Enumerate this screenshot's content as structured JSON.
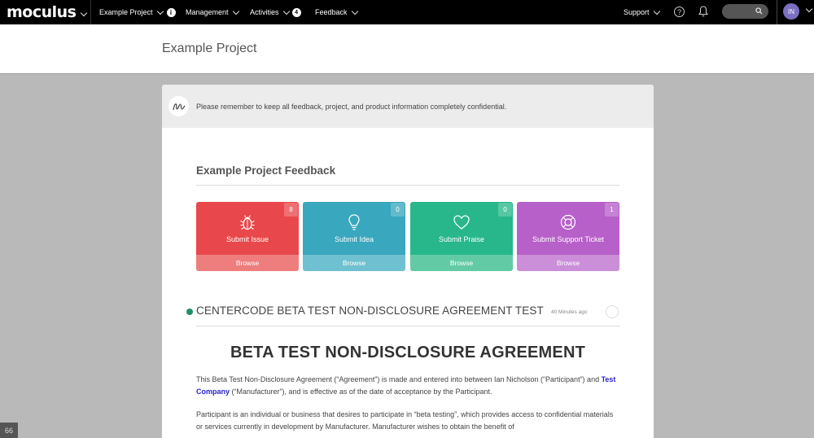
{
  "nav": {
    "brand": "moculus",
    "items": [
      {
        "label": "Example Project",
        "badge": "i"
      },
      {
        "label": "Management"
      },
      {
        "label": "Activities",
        "badge": "4"
      },
      {
        "label": "Feedback"
      }
    ],
    "support": "Support",
    "avatar_initials": "IN"
  },
  "page": {
    "title": "Example Project"
  },
  "notice": {
    "text": "Please remember to keep all feedback, project, and product information completely confidential."
  },
  "feedback": {
    "title": "Example Project Feedback",
    "tiles": [
      {
        "label": "Submit Issue",
        "count": "8",
        "browse": "Browse",
        "color": "#e8484b",
        "bottom_color": "#ee7e7e",
        "icon": "bug-icon"
      },
      {
        "label": "Submit Idea",
        "count": "0",
        "browse": "Browse",
        "color": "#39a7bd",
        "bottom_color": "#6fc0d0",
        "icon": "lightbulb-icon"
      },
      {
        "label": "Submit Praise",
        "count": "0",
        "browse": "Browse",
        "color": "#28b78a",
        "bottom_color": "#62cba6",
        "icon": "heart-icon"
      },
      {
        "label": "Submit Support Ticket",
        "count": "1",
        "browse": "Browse",
        "color": "#b760c9",
        "bottom_color": "#cb8ed8",
        "icon": "lifebuoy-icon"
      }
    ]
  },
  "announcement": {
    "title": "CENTERCODE BETA TEST NON-DISCLOSURE AGREEMENT TEST",
    "time": "40 Minutes ago",
    "status_color": "#1e8f6b"
  },
  "document": {
    "title": "BETA TEST NON-DISCLOSURE AGREEMENT",
    "p1_a": "This Beta Test Non-Disclosure Agreement (“Agreement”) is made and entered into between Ian Nicholson (“Participant”) and ",
    "p1_link": "Test Company",
    "p1_b": " (“Manufacturer”), and is effective as of the date of acceptance by the Participant.",
    "p2": "Participant is an individual or business that desires to participate in “beta testing”, which provides access to confidential materials or services currently in development by Manufacturer. Manufacturer wishes to obtain the benefit of"
  },
  "corner": {
    "label": "66"
  }
}
